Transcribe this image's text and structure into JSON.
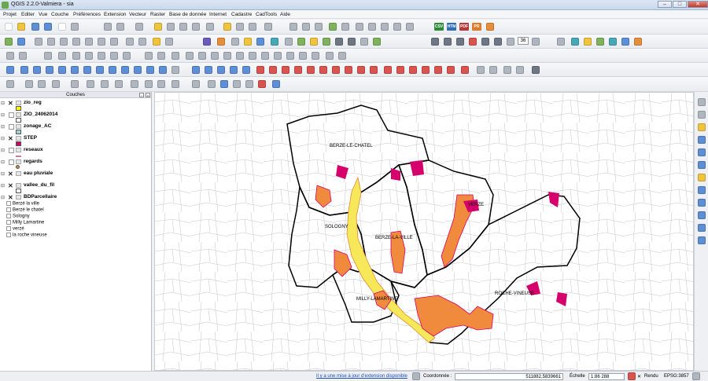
{
  "window": {
    "title": "QGIS 2.2.0-Valmiera - sia"
  },
  "menu": [
    "Projet",
    "Editer",
    "Vue",
    "Couche",
    "Préférences",
    "Extension",
    "Vecteur",
    "Raster",
    "Base de donnée",
    "Internet",
    "Cadastre",
    "CadTools",
    "Aide"
  ],
  "toolbar": {
    "export_buttons": [
      "CSV",
      "HTM",
      "PDF",
      "PR"
    ],
    "rotation_value": "36"
  },
  "layers_panel": {
    "title": "Couches",
    "layers": [
      {
        "name": "zio_reg",
        "visible": true,
        "color": "#ffff00"
      },
      {
        "name": "ZIO_24062014",
        "visible": false,
        "color": "#ffffff"
      },
      {
        "name": "zonage_AC",
        "visible": true,
        "color": "#9dd3d3"
      },
      {
        "name": "STEP",
        "visible": true,
        "color": "#d4006a"
      },
      {
        "name": "reseaux",
        "visible": false,
        "color": "#c97aa0"
      },
      {
        "name": "regards",
        "visible": false,
        "color": "#c98a3a"
      },
      {
        "name": "eau pluviale",
        "visible": true,
        "color": "#888888"
      },
      {
        "name": "vallee_du_fil",
        "visible": true,
        "color": "#ffffff"
      },
      {
        "name": "BDParcellaire",
        "visible": true,
        "color": "#ffffff"
      }
    ],
    "sublayers": [
      "Berzé la ville",
      "Berzé le chatel",
      "Sologny",
      "Milly Lamartine",
      "verzé",
      "la roche vineuse"
    ]
  },
  "map": {
    "labels": [
      "BERZE-LE-CHATEL",
      "SOLOGNY",
      "BERZE-LA-VILLE",
      "VERZE",
      "MILLY-LAMARTINE",
      "ROCHE-VINEUSE"
    ]
  },
  "status": {
    "update_link": "Il y a une mise à jour d'extension disponible",
    "coord_label": "Coordonnée :",
    "coord_value": "511882,5839661",
    "scale_label": "Échelle",
    "scale_value": "1:86 288",
    "render_label": "Rendu",
    "crs": "EPSG:3857"
  },
  "colors": {
    "zone_fill": "#f08a3c",
    "zone_magenta": "#d6006c",
    "zone_yellow": "#f7e85a",
    "commune_border": "#000000"
  }
}
